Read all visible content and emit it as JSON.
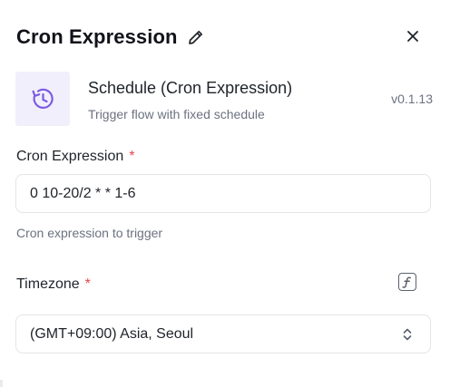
{
  "header": {
    "title": "Cron Expression",
    "edit_icon": "pencil-icon",
    "close_icon": "close-icon"
  },
  "node": {
    "icon": "clock-icon",
    "title": "Schedule (Cron Expression)",
    "description": "Trigger flow with fixed schedule",
    "version": "v0.1.13"
  },
  "cron_field": {
    "label": "Cron Expression",
    "required_mark": "*",
    "value": "0 10-20/2 * * 1-6",
    "helper": "Cron expression to trigger"
  },
  "timezone_field": {
    "label": "Timezone",
    "required_mark": "*",
    "selected": "(GMT+09:00) Asia, Seoul",
    "fx_icon": "function-icon",
    "chevron_icon": "chevron-up-down-icon"
  },
  "colors": {
    "accent_purple": "#7c5ce0",
    "icon_bg": "#f2effc",
    "required_red": "#e5484d",
    "muted_text": "#6b7280",
    "border": "#e3e5e8"
  }
}
